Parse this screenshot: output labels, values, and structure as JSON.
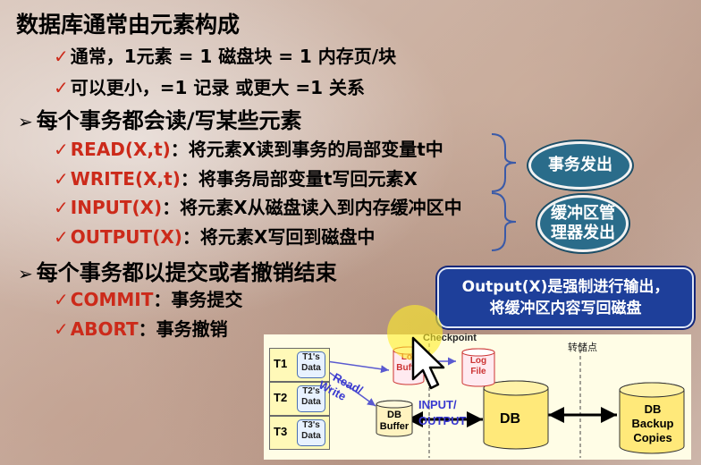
{
  "slide": {
    "title": "数据库通常由元素构成",
    "sub1": {
      "check": "✓",
      "text": "通常，1元素 = 1 磁盘块 = 1 内存页/块"
    },
    "sub2": {
      "check": "✓",
      "text": "可以更小，=1 记录 或更大 =1 关系"
    },
    "heading2": {
      "mark": "➢",
      "text": "每个事务都会读/写某些元素"
    },
    "ops": [
      {
        "check": "✓",
        "op": "READ(X,t)",
        "desc": "：将元素X读到事务的局部变量t中"
      },
      {
        "check": "✓",
        "op": "WRITE(X,t)",
        "desc": "：将事务局部变量t写回元素X"
      },
      {
        "check": "✓",
        "op": "INPUT(X)",
        "desc": "：将元素X从磁盘读入到内存缓冲区中"
      },
      {
        "check": "✓",
        "op": "OUTPUT(X)",
        "desc": "：将元素X写回到磁盘中"
      }
    ],
    "heading3": {
      "mark": "➢",
      "text": "每个事务都以提交或者撤销结束"
    },
    "ops2": [
      {
        "check": "✓",
        "op": "COMMIT",
        "desc": "：事务提交"
      },
      {
        "check": "✓",
        "op": "ABORT",
        "desc": "：事务撤销"
      }
    ],
    "oval1": "事务发出",
    "oval2": {
      "line1": "缓冲区管",
      "line2": "理器发出"
    },
    "callout": {
      "line1": "Output(X)是强制进行输出，",
      "line2": "将缓冲区内容写回磁盘"
    }
  },
  "diagram": {
    "transactions": [
      {
        "label": "T1",
        "data_line1": "T1's",
        "data_line2": "Data"
      },
      {
        "label": "T2",
        "data_line1": "T2's",
        "data_line2": "Data"
      },
      {
        "label": "T3",
        "data_line1": "T3's",
        "data_line2": "Data"
      }
    ],
    "read_write_1": "Read/",
    "read_write_2": "Write",
    "checkpoint": "Checkpoint",
    "log_buffer_1": "Log",
    "log_buffer_2": "Buffer",
    "log_file_1": "Log",
    "log_file_2": "File",
    "db_buffer_1": "DB",
    "db_buffer_2": "Buffer",
    "input_output_1": "INPUT/",
    "input_output_2": "OUTPUT",
    "db": "DB",
    "transfer_point": "转储点",
    "backup_1": "DB",
    "backup_2": "Backup",
    "backup_3": "Copies"
  },
  "colors": {
    "accent_red": "#cc2a1a",
    "oval_blue": "#2a6c8a",
    "callout_blue": "#1e3f9a",
    "db_yellow": "#ffe97a"
  }
}
